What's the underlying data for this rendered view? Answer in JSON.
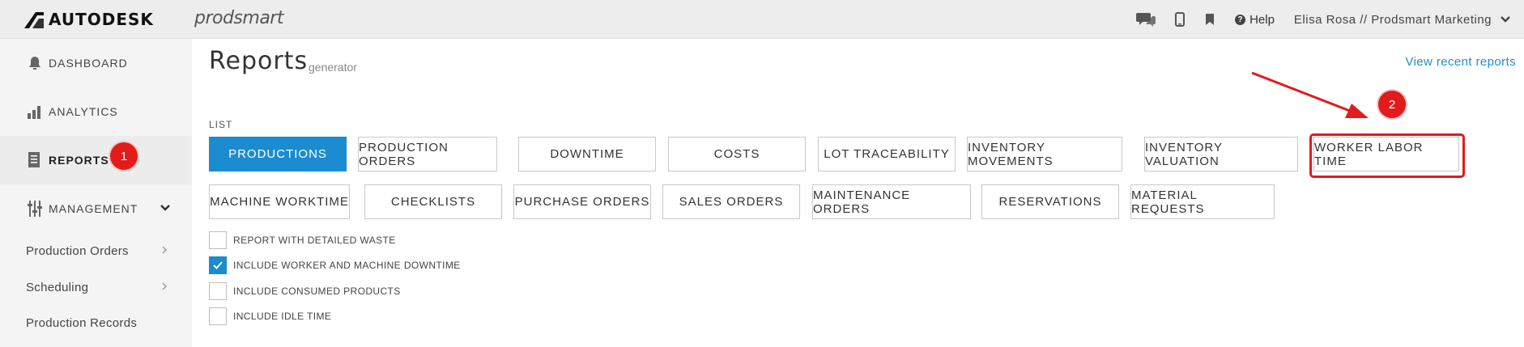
{
  "topbar": {
    "brand": "AUTODESK",
    "product": "prodsmart",
    "help_label": "Help",
    "user_label": "Elisa Rosa // Prodsmart Marketing",
    "icons": [
      "chat-icon",
      "mobile-icon",
      "bookmark-icon",
      "help-icon",
      "chevron-down-icon"
    ]
  },
  "sidebar": {
    "items": [
      {
        "label": "DASHBOARD",
        "icon": "bell-icon"
      },
      {
        "label": "ANALYTICS",
        "icon": "bar-chart-icon"
      },
      {
        "label": "REPORTS",
        "icon": "document-icon",
        "active": true
      },
      {
        "label": "MANAGEMENT",
        "icon": "sliders-icon"
      }
    ],
    "sub_items": [
      {
        "label": "Production Orders"
      },
      {
        "label": "Scheduling"
      },
      {
        "label": "Production Records"
      }
    ]
  },
  "main": {
    "title": "Reports",
    "subtitle": "generator",
    "recent_link": "View recent reports",
    "list_label": "LIST",
    "report_types": [
      "PRODUCTIONS",
      "PRODUCTION ORDERS",
      "DOWNTIME",
      "COSTS",
      "LOT TRACEABILITY",
      "INVENTORY MOVEMENTS",
      "INVENTORY VALUATION",
      "WORKER LABOR TIME",
      "MACHINE WORKTIME",
      "CHECKLISTS",
      "PURCHASE ORDERS",
      "SALES ORDERS",
      "MAINTENANCE ORDERS",
      "RESERVATIONS",
      "MATERIAL REQUESTS"
    ],
    "selected_report": "PRODUCTIONS",
    "options": [
      {
        "label": "REPORT WITH DETAILED WASTE",
        "checked": false
      },
      {
        "label": "INCLUDE WORKER AND MACHINE DOWNTIME",
        "checked": true
      },
      {
        "label": "INCLUDE CONSUMED PRODUCTS",
        "checked": false
      },
      {
        "label": "INCLUDE IDLE TIME",
        "checked": false
      }
    ]
  },
  "annotations": {
    "badge_1": "1",
    "badge_2": "2",
    "color": "#e21b1b"
  },
  "colors": {
    "accent": "#1a8ccf",
    "link": "#1e8fcf"
  }
}
